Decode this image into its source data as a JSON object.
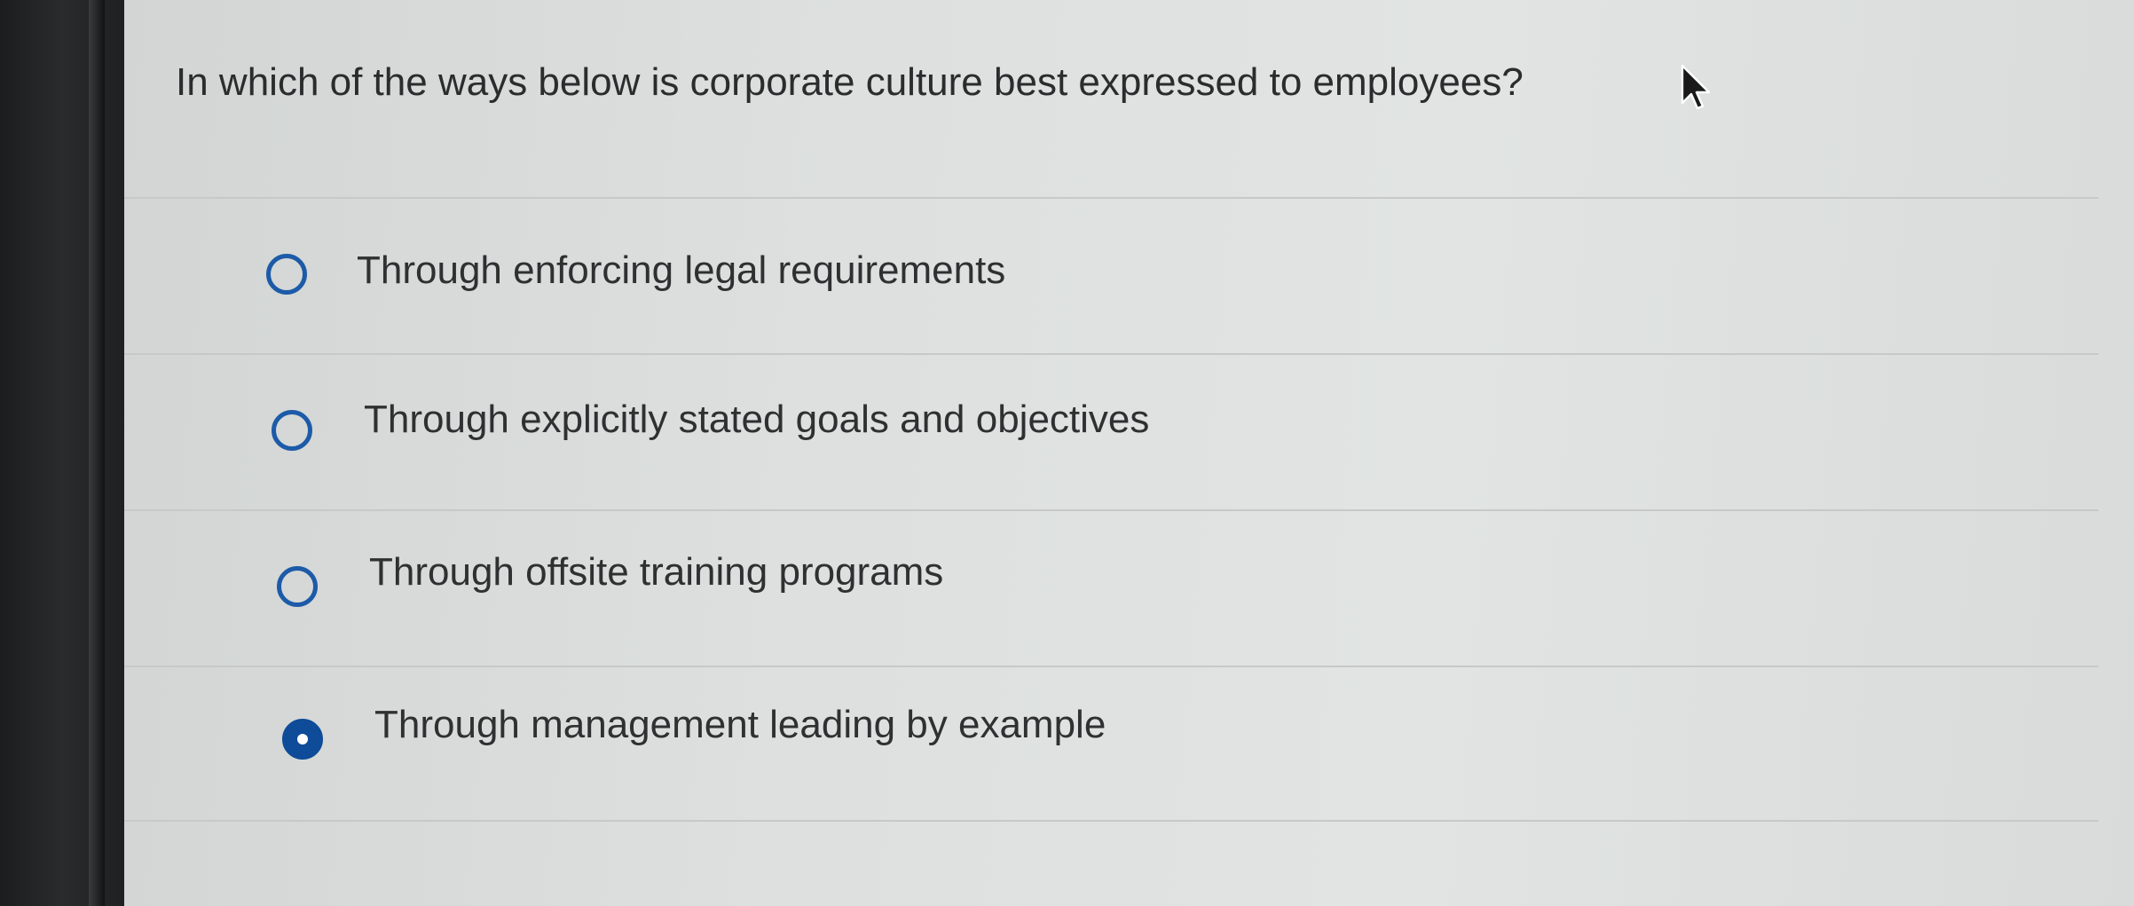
{
  "question": {
    "text": "In which of the ways below is corporate culture best expressed to employees?"
  },
  "options": [
    {
      "label": "Through enforcing legal requirements",
      "selected": false
    },
    {
      "label": "Through explicitly stated goals and objectives",
      "selected": false
    },
    {
      "label": "Through offsite training programs",
      "selected": false
    },
    {
      "label": "Through management leading by example",
      "selected": true
    }
  ],
  "icons": {
    "cursor": "mouse-pointer-icon"
  },
  "colors": {
    "radio_accent": "#0e4b98",
    "text": "#2f3031",
    "background": "#dde0df"
  }
}
